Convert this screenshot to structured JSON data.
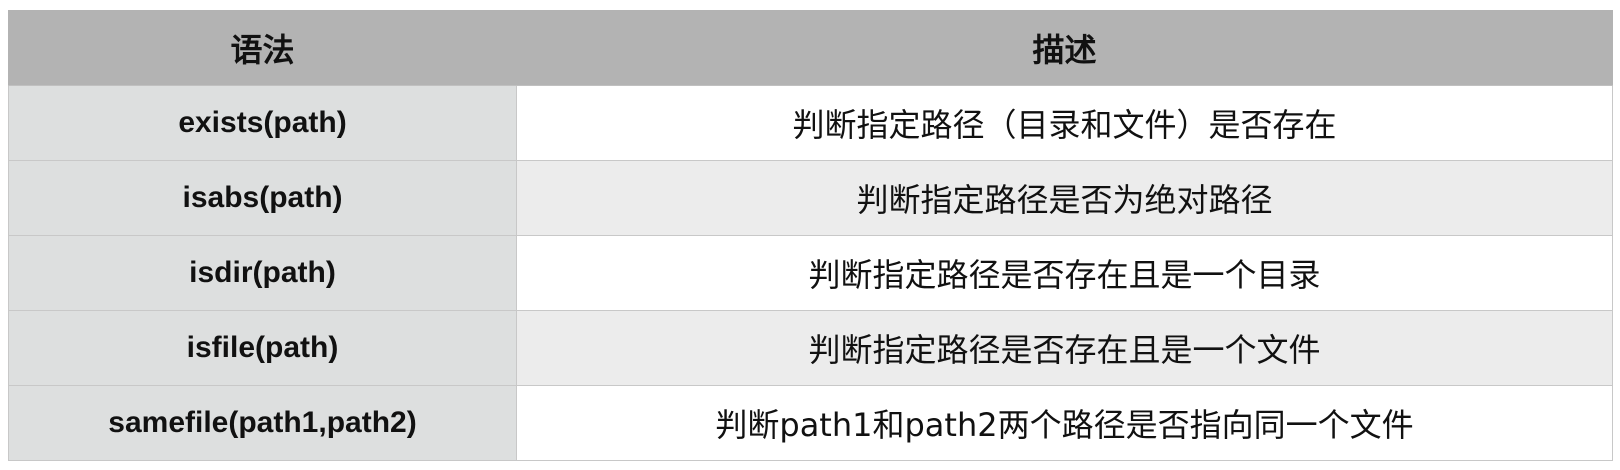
{
  "table": {
    "headers": [
      "语法",
      "描述"
    ],
    "rows": [
      {
        "syntax": "exists(path)",
        "description": "判断指定路径（目录和文件）是否存在"
      },
      {
        "syntax": "isabs(path)",
        "description": "判断指定路径是否为绝对路径"
      },
      {
        "syntax": "isdir(path)",
        "description": "判断指定路径是否存在且是一个目录"
      },
      {
        "syntax": "isfile(path)",
        "description": "判断指定路径是否存在且是一个文件"
      },
      {
        "syntax": "samefile(path1,path2)",
        "description": "判断path1和path2两个路径是否指向同一个文件"
      }
    ]
  },
  "colors": {
    "header_bg": "#b3b3b3",
    "syntax_col_bg": "#dddfdf",
    "alt_row_bg": "#ececec",
    "row_bg": "#ffffff",
    "border": "#c8c8c8"
  }
}
